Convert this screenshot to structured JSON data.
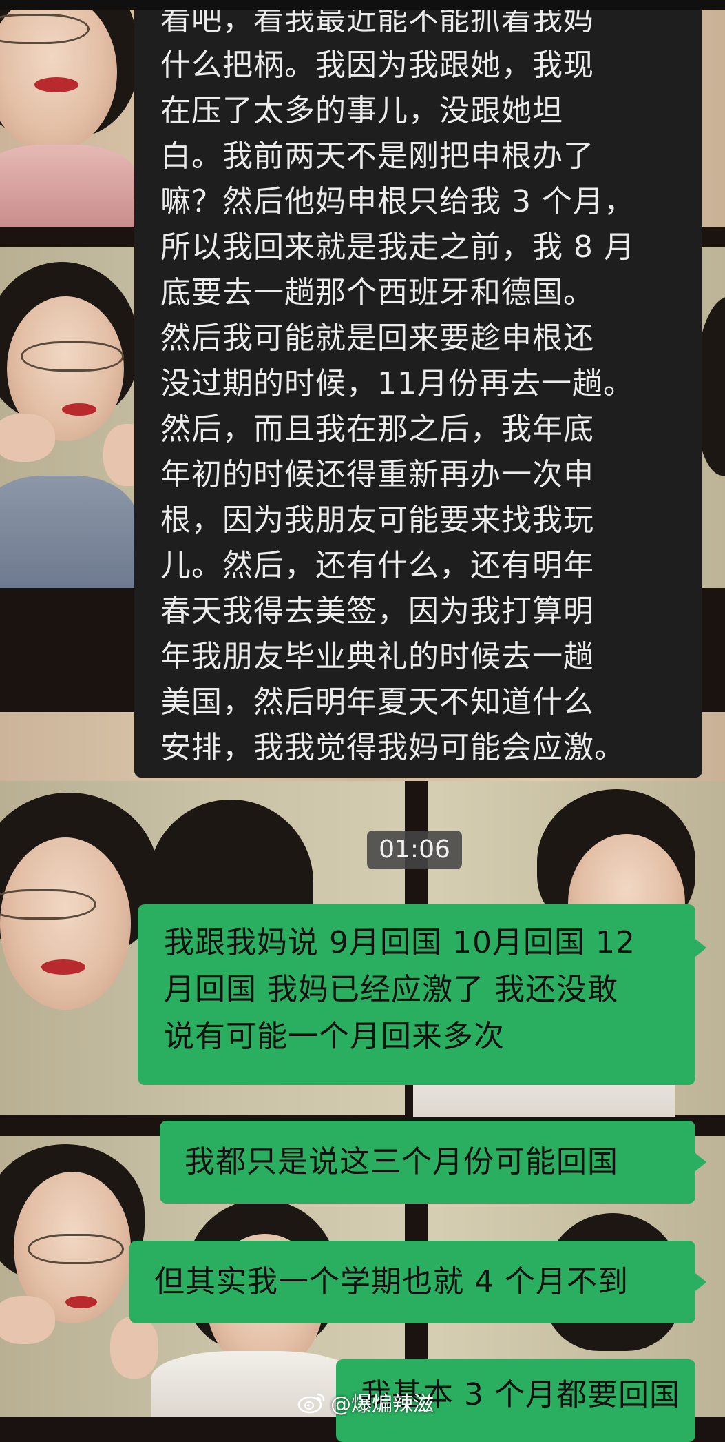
{
  "incoming_message": {
    "lines": [
      "看吧，看我最近能不能抓着我妈",
      "什么把柄。我因为我跟她，我现",
      "在压了太多的事儿，没跟她坦",
      "白。我前两天不是刚把申根办了",
      "嘛？然后他妈申根只给我 3 个月，",
      "所以我回来就是我走之前，我 8 月",
      "底要去一趟那个西班牙和德国。",
      "然后我可能就是回来要趁申根还",
      "没过期的时候，11月份再去一趟。",
      "然后，而且我在那之后，我年底",
      "年初的时候还得重新再办一次申",
      "根，因为我朋友可能要来找我玩",
      "儿。然后，还有什么，还有明年",
      "春天我得去美签，因为我打算明",
      "年我朋友毕业典礼的时候去一趟",
      "美国，然后明年夏天不知道什么",
      "安排，我我觉得我妈可能会应激。"
    ]
  },
  "timestamp": "01:06",
  "outgoing_messages": [
    {
      "lines": [
        "我跟我妈说 9月回国 10月回国 12",
        "月回国 我妈已经应激了 我还没敢",
        "说有可能一个月回来多次"
      ]
    },
    {
      "lines": [
        "我都只是说这三个月份可能回国"
      ]
    },
    {
      "lines": [
        "但其实我一个学期也就 4 个月不到"
      ]
    },
    {
      "lines": [
        "我基本 3 个月都要回国"
      ]
    }
  ],
  "watermark": {
    "text": "@爆煸辣滋",
    "icon": "weibo-icon"
  },
  "colors": {
    "incoming_bubble": "#1e1e1e",
    "outgoing_bubble": "#2aae5f",
    "timestamp_chip": "#464646"
  }
}
